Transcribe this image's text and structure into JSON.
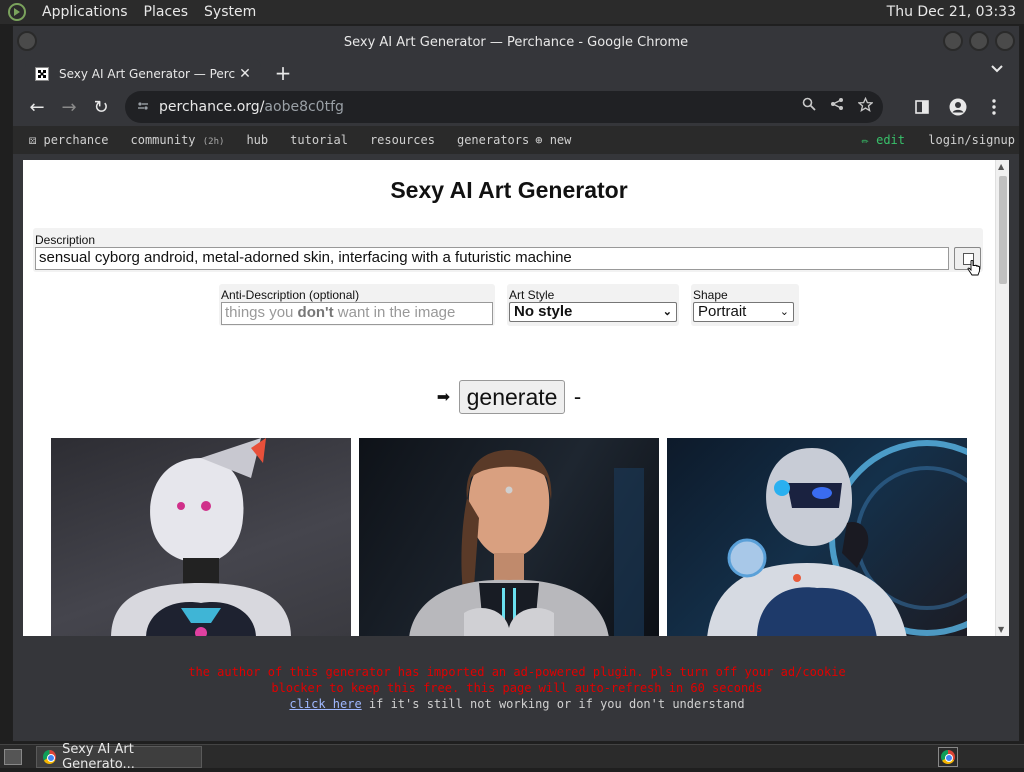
{
  "panel": {
    "menus": [
      "Applications",
      "Places",
      "System"
    ],
    "clock": "Thu Dec 21, 03:33"
  },
  "window": {
    "title": "Sexy AI Art Generator — Perchance - Google Chrome"
  },
  "tab": {
    "title": "Sexy AI Art Generator — Perchance",
    "close": "✕",
    "new_tab": "+",
    "tab_menu": "⌄"
  },
  "toolbar": {
    "back": "←",
    "forward": "→",
    "reload": "↻",
    "url_host": "perchance.org/",
    "url_path": "aobe8c0tfg",
    "icons": [
      "zoom-icon",
      "share-icon",
      "bookmark-star-icon",
      "sidepanel-icon",
      "profile-icon",
      "menu-icon"
    ]
  },
  "sitenav": {
    "home": "perchance",
    "community": "community",
    "community_badge": "(2h)",
    "hub": "hub",
    "tutorial": "tutorial",
    "resources": "resources",
    "generators": "generators",
    "new": "new",
    "edit": "edit",
    "login": "login/signup"
  },
  "page": {
    "title": "Sexy AI Art Generator",
    "description_label": "Description",
    "description_value": "sensual cyborg android, metal-adorned skin, interfacing with a futuristic machine",
    "anti_label": "Anti-Description (optional)",
    "anti_placeholder_pre": "things you ",
    "anti_placeholder_bold": "don't",
    "anti_placeholder_post": " want in the image",
    "style_label": "Art Style",
    "style_value": "No style",
    "shape_label": "Shape",
    "shape_value": "Portrait",
    "generate_arrow": "➡",
    "generate_label": "generate",
    "generate_dash": "-"
  },
  "adwarn": {
    "line1": "the author of this generator has imported an ad-powered plugin. pls turn off your ad/cookie",
    "line2": "blocker to keep this free. this page will auto-refresh in 60 seconds",
    "link": "click here",
    "line3_rest": " if it's still not working or if you don't understand"
  },
  "taskbar": {
    "task_label": "Sexy AI Art Generato..."
  },
  "colors": {
    "edit_green": "#38c06a",
    "warning_red": "#e00000",
    "link_blue": "#9fb8ff"
  }
}
